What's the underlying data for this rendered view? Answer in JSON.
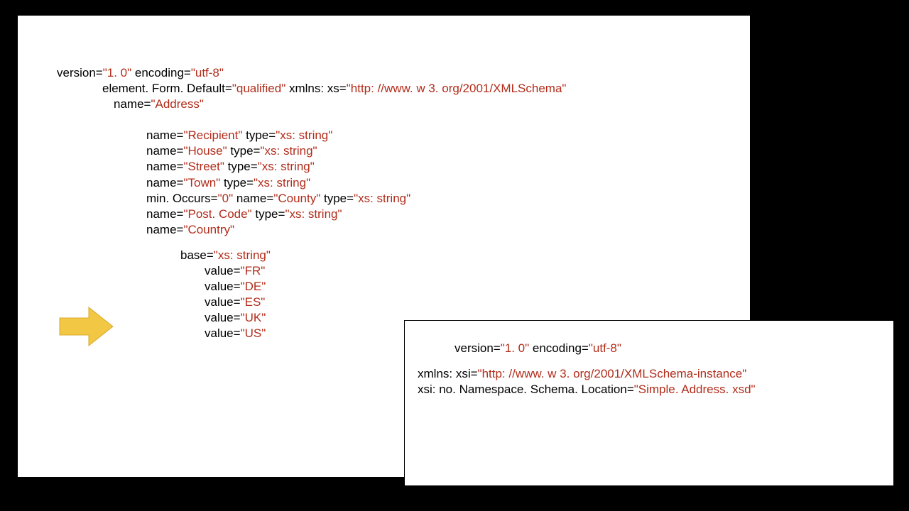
{
  "schema": {
    "l1": {
      "a1n": "version=",
      "a1v": "\"1. 0\"",
      "a2n": " encoding=",
      "a2v": "\"utf-8\""
    },
    "l2": {
      "a1n": "element. Form. Default=",
      "a1v": "\"qualified\"",
      "a2n": " xmlns: xs=",
      "a2v": "\"http: //www. w 3. org/2001/XMLSchema\""
    },
    "l3": {
      "a1n": "name=",
      "a1v": "\"Address\""
    },
    "elements": [
      {
        "n1": "name=",
        "v1": "\"Recipient\"",
        "n2": " type=",
        "v2": "\"xs: string\""
      },
      {
        "n1": "name=",
        "v1": "\"House\"",
        "n2": " type=",
        "v2": "\"xs: string\""
      },
      {
        "n1": "name=",
        "v1": "\"Street\"",
        "n2": " type=",
        "v2": "\"xs: string\""
      },
      {
        "n1": "name=",
        "v1": "\"Town\"",
        "n2": " type=",
        "v2": "\"xs: string\""
      },
      {
        "n1": "min. Occurs=",
        "v1": "\"0\"",
        "n2": " name=",
        "v2": "\"County\"",
        "n3": " type=",
        "v3": "\"xs: string\""
      },
      {
        "n1": "name=",
        "v1": "\"Post. Code\"",
        "n2": " type=",
        "v2": "\"xs: string\""
      },
      {
        "n1": "name=",
        "v1": "\"Country\""
      }
    ],
    "base": {
      "n": "base=",
      "v": "\"xs: string\""
    },
    "enums": [
      {
        "n": "value=",
        "v": "\"FR\""
      },
      {
        "n": "value=",
        "v": "\"DE\""
      },
      {
        "n": "value=",
        "v": "\"ES\""
      },
      {
        "n": "value=",
        "v": "\"UK\""
      },
      {
        "n": "value=",
        "v": "\"US\""
      }
    ]
  },
  "instance": {
    "l1": {
      "a1n": "version=",
      "a1v": "\"1. 0\"",
      "a2n": " encoding=",
      "a2v": "\"utf-8\""
    },
    "l2": {
      "a1n": "xmlns: xsi=",
      "a1v": "\"http: //www. w 3. org/2001/XMLSchema-instance\""
    },
    "l3": {
      "a1n": "xsi: no. Namespace. Schema. Location=",
      "a1v": "\"Simple. Address. xsd\""
    }
  }
}
